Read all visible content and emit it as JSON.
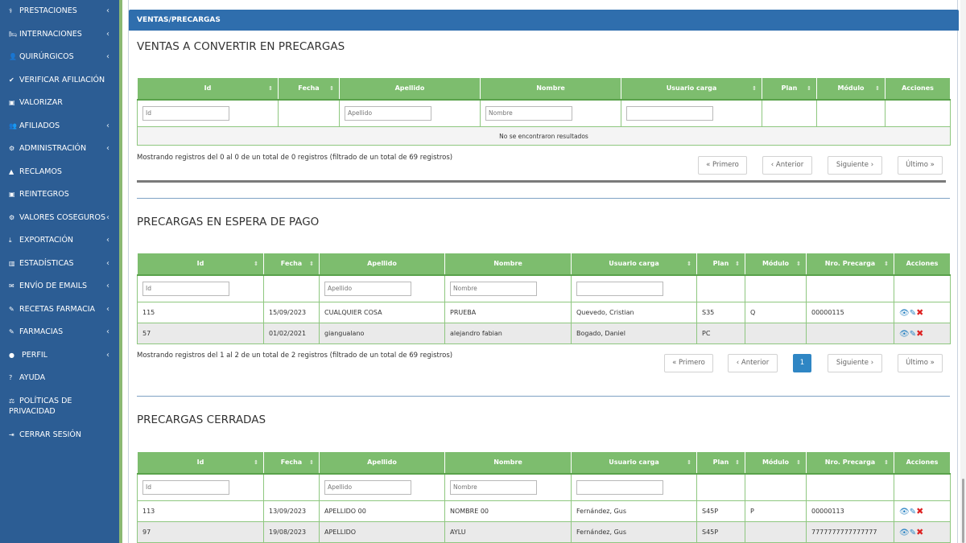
{
  "sidebar": {
    "items": [
      {
        "icon": "stethoscope-icon",
        "glyph": "⚕",
        "label": "PRESTACIONES",
        "has_submenu": true
      },
      {
        "icon": "bed-icon",
        "glyph": "🛏",
        "label": "INTERNACIONES",
        "has_submenu": true
      },
      {
        "icon": "user-doctor-icon",
        "glyph": "👤",
        "label": "QUIRÚRGICOS",
        "has_submenu": true
      },
      {
        "icon": "check-icon",
        "glyph": "✔",
        "label": "VERIFICAR AFILIACIÓN",
        "has_submenu": false
      },
      {
        "icon": "money-icon",
        "glyph": "▣",
        "label": "VALORIZAR",
        "has_submenu": false
      },
      {
        "icon": "users-icon",
        "glyph": "👥",
        "label": "AFILIADOS",
        "has_submenu": true
      },
      {
        "icon": "gears-icon",
        "glyph": "⚙",
        "label": "ADMINISTRACIÓN",
        "has_submenu": true
      },
      {
        "icon": "warning-icon",
        "glyph": "▲",
        "label": "RECLAMOS",
        "has_submenu": false
      },
      {
        "icon": "money-icon",
        "glyph": "▣",
        "label": "REINTEGROS",
        "has_submenu": false
      },
      {
        "icon": "gears-icon",
        "glyph": "⚙",
        "label": "VALORES COSEGUROS",
        "has_submenu": true
      },
      {
        "icon": "download-icon",
        "glyph": "⤓",
        "label": "EXPORTACIÓN",
        "has_submenu": true
      },
      {
        "icon": "bar-chart-icon",
        "glyph": "▥",
        "label": "ESTADÍSTICAS",
        "has_submenu": true
      },
      {
        "icon": "envelope-icon",
        "glyph": "✉",
        "label": "ENVÍO DE EMAILS",
        "has_submenu": true
      },
      {
        "icon": "prescription-icon",
        "glyph": "✎",
        "label": "RECETAS FARMACIA",
        "has_submenu": true
      },
      {
        "icon": "pharmacy-icon",
        "glyph": "✎",
        "label": "FARMACIAS",
        "has_submenu": true
      },
      {
        "icon": "user-circle-icon",
        "glyph": "●",
        "label": " PERFIL",
        "has_submenu": true
      },
      {
        "icon": "help-icon",
        "glyph": "?",
        "label": "AYUDA",
        "has_submenu": false
      },
      {
        "icon": "gavel-icon",
        "glyph": "⚖",
        "label": "POLÍTICAS DE PRIVACIDAD",
        "has_submenu": false
      },
      {
        "icon": "sign-out-icon",
        "glyph": "⇥",
        "label": "CERRAR SESIÓN",
        "has_submenu": false
      }
    ]
  },
  "panel": {
    "title": "VENTAS/PRECARGAS"
  },
  "sections": {
    "ventas": {
      "title": "VENTAS A CONVERTIR EN PRECARGAS",
      "columns": [
        "Id",
        "Fecha",
        "Apellido",
        "Nombre",
        "Usuario carga",
        "Plan",
        "Módulo",
        "Acciones"
      ],
      "filters": {
        "id": "Id",
        "apellido": "Apellido",
        "nombre": "Nombre"
      },
      "empty": "No se encontraron resultados",
      "info": "Mostrando registros del 0 al 0 de un total de 0 registros (filtrado de un total de 69 registros)",
      "pagination": {
        "first": "« Primero",
        "prev": "‹  Anterior",
        "next": "Siguiente  ›",
        "last": "Último »"
      }
    },
    "espera": {
      "title": "PRECARGAS EN ESPERA DE PAGO",
      "columns": [
        "Id",
        "Fecha",
        "Apellido",
        "Nombre",
        "Usuario carga",
        "Plan",
        "Módulo",
        "Nro. Precarga",
        "Acciones"
      ],
      "filters": {
        "id": "Id",
        "apellido": "Apellido",
        "nombre": "Nombre"
      },
      "rows": [
        [
          "115",
          "15/09/2023",
          "CUALQUIER COSA",
          "PRUEBA",
          "Quevedo, Cristian",
          "S35",
          "Q",
          "00000115"
        ],
        [
          "57",
          "01/02/2021",
          "giangualano",
          "alejandro fabian",
          "Bogado, Daniel",
          "PC",
          "",
          ""
        ]
      ],
      "info": "Mostrando registros del 1 al 2 de un total de 2 registros (filtrado de un total de 69 registros)",
      "pagination": {
        "first": "« Primero",
        "prev": "‹  Anterior",
        "page": "1",
        "next": "Siguiente  ›",
        "last": "Último »"
      }
    },
    "cerradas": {
      "title": "PRECARGAS CERRADAS",
      "columns": [
        "Id",
        "Fecha",
        "Apellido",
        "Nombre",
        "Usuario carga",
        "Plan",
        "Módulo",
        "Nro. Precarga",
        "Acciones"
      ],
      "filters": {
        "id": "Id",
        "apellido": "Apellido",
        "nombre": "Nombre"
      },
      "rows": [
        [
          "113",
          "13/09/2023",
          "APELLIDO 00",
          "NOMBRE 00",
          "Fernández, Gus",
          "S45P",
          "P",
          "00000113"
        ],
        [
          "97",
          "19/08/2023",
          "APELLIDO",
          "AYLU",
          "Fernández, Gus",
          "S45P",
          "",
          "7777777777777777"
        ]
      ]
    }
  },
  "icons": {
    "sort": "⇕",
    "chevron": "‹",
    "view": "👁",
    "edit": "✎",
    "delete": "✖"
  },
  "colors": {
    "sidebar": "#2c5d94",
    "header": "#2f6ead",
    "table_header": "#7dbd6e",
    "accent": "#2f86c4"
  }
}
